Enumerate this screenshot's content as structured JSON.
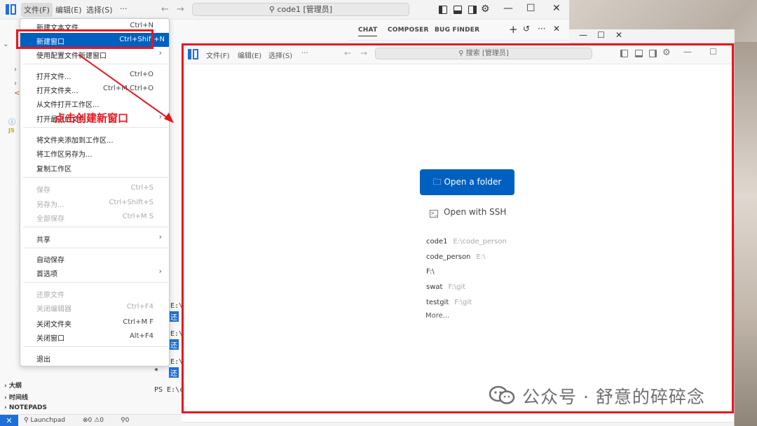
{
  "main_window": {
    "menu": [
      "文件(F)",
      "编辑(E)",
      "选择(S)",
      "···"
    ],
    "search_label": "code1 [管理员]",
    "chat_tabs": [
      "CHAT",
      "COMPOSER",
      "BUG FINDER"
    ],
    "window_controls": {
      "minimize": "—",
      "maximize": "☐",
      "close": "✕"
    }
  },
  "file_menu": {
    "items": [
      {
        "label": "新建文本文件",
        "shortcut": "Ctrl+N"
      },
      {
        "label": "新建窗口",
        "shortcut": "Ctrl+Shift+N"
      },
      {
        "label": "使用配置文件新建窗口",
        "shortcut": "",
        "submenu": true
      },
      {
        "label": "打开文件...",
        "shortcut": "Ctrl+O"
      },
      {
        "label": "打开文件夹...",
        "shortcut": "Ctrl+M Ctrl+O"
      },
      {
        "label": "从文件打开工作区...",
        "shortcut": ""
      },
      {
        "label": "打开最近的文件",
        "shortcut": "",
        "submenu": true
      },
      {
        "label": "将文件夹添加到工作区...",
        "shortcut": ""
      },
      {
        "label": "将工作区另存为...",
        "shortcut": ""
      },
      {
        "label": "复制工作区",
        "shortcut": ""
      },
      {
        "label": "保存",
        "shortcut": "Ctrl+S"
      },
      {
        "label": "另存为...",
        "shortcut": "Ctrl+Shift+S"
      },
      {
        "label": "全部保存",
        "shortcut": "Ctrl+M S"
      },
      {
        "label": "共享",
        "shortcut": "",
        "submenu": true
      },
      {
        "label": "自动保存",
        "shortcut": ""
      },
      {
        "label": "首选项",
        "shortcut": "",
        "submenu": true
      },
      {
        "label": "还原文件",
        "shortcut": ""
      },
      {
        "label": "关闭编辑器",
        "shortcut": "Ctrl+F4"
      },
      {
        "label": "关闭文件夹",
        "shortcut": "Ctrl+M F"
      },
      {
        "label": "关闭窗口",
        "shortcut": "Alt+F4"
      },
      {
        "label": "退出",
        "shortcut": ""
      }
    ]
  },
  "annotation": {
    "text": "点击创建新窗口",
    "color": "#e8151f"
  },
  "sidebar_sections": [
    "大纲",
    "时间线",
    "NOTEPADS"
  ],
  "status_bar": {
    "launchpad": "Launchpad",
    "errors": "0",
    "warnings": "0",
    "ports": "0"
  },
  "terminal": {
    "prompt_prefix": "E:\\c",
    "ps_line": "PS E:\\c",
    "highlight_char": "还"
  },
  "new_window": {
    "menu": [
      "文件(F)",
      "编辑(E)",
      "选择(S)",
      "···"
    ],
    "search_label": "搜索 [管理员]",
    "open_folder_label": "Open a folder",
    "ssh_label": "Open with SSH",
    "recent": [
      {
        "name": "code1",
        "path": "E:\\code_person"
      },
      {
        "name": "code_person",
        "path": "E:\\"
      },
      {
        "name": "F:\\",
        "path": ""
      },
      {
        "name": "swat",
        "path": "F:\\git"
      },
      {
        "name": "testgit",
        "path": "F:\\git"
      }
    ],
    "more_label": "More..."
  },
  "watermark": "公众号 · 舒意的碎碎念",
  "colors": {
    "accent": "#0060c0",
    "annotation": "#e8151f"
  }
}
